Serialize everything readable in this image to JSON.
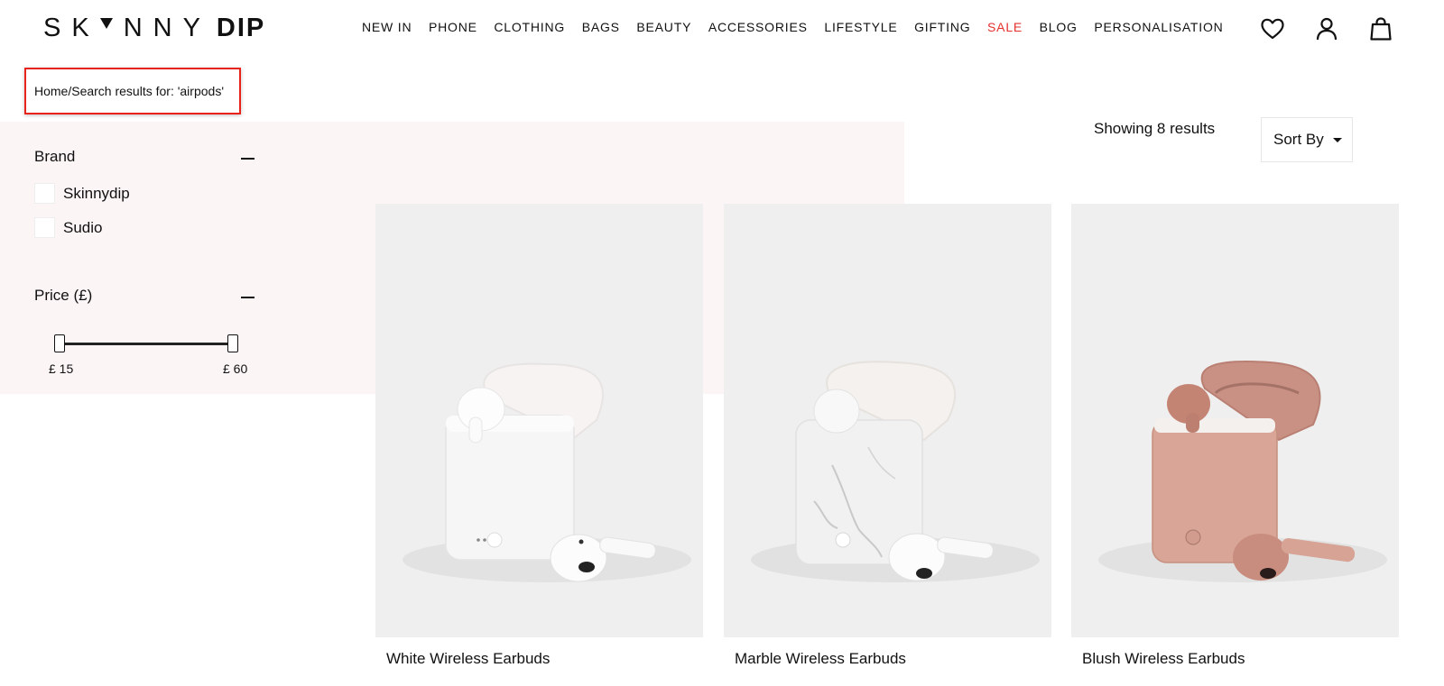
{
  "header": {
    "logo": {
      "part1": "SK",
      "part2": "NNY",
      "part3": "DIP"
    },
    "nav": [
      {
        "label": "NEW IN"
      },
      {
        "label": "PHONE"
      },
      {
        "label": "CLOTHING"
      },
      {
        "label": "BAGS"
      },
      {
        "label": "BEAUTY"
      },
      {
        "label": "ACCESSORIES"
      },
      {
        "label": "LIFESTYLE"
      },
      {
        "label": "GIFTING"
      },
      {
        "label": "SALE"
      },
      {
        "label": "BLOG"
      },
      {
        "label": "PERSONALISATION"
      }
    ],
    "icons": [
      "heart-icon",
      "user-icon",
      "bag-icon"
    ]
  },
  "breadcrumb": {
    "text": "Home/Search results for: 'airpods'"
  },
  "filters": {
    "brand": {
      "title": "Brand",
      "options": [
        {
          "label": "Skinnydip",
          "checked": false
        },
        {
          "label": "Sudio",
          "checked": false
        }
      ]
    },
    "price": {
      "title": "Price (£)",
      "min_label": "£ 15",
      "max_label": "£ 60",
      "min": 15,
      "max": 60
    }
  },
  "results": {
    "count_text": "Showing 8 results",
    "sort_label": "Sort By"
  },
  "products": [
    {
      "title": "White Wireless Earbuds",
      "case_color": "#f6f6f6",
      "bud_color": "#ffffff"
    },
    {
      "title": "Marble Wireless Earbuds",
      "case_color": "#f1f1f1",
      "bud_color": "#ffffff"
    },
    {
      "title": "Blush Wireless Earbuds",
      "case_color": "#d9a596",
      "bud_color": "#c88d7f"
    }
  ],
  "colors": {
    "sale": "#e5312e",
    "filter_bg": "#fcf5f6",
    "highlight": "#e8231b"
  }
}
